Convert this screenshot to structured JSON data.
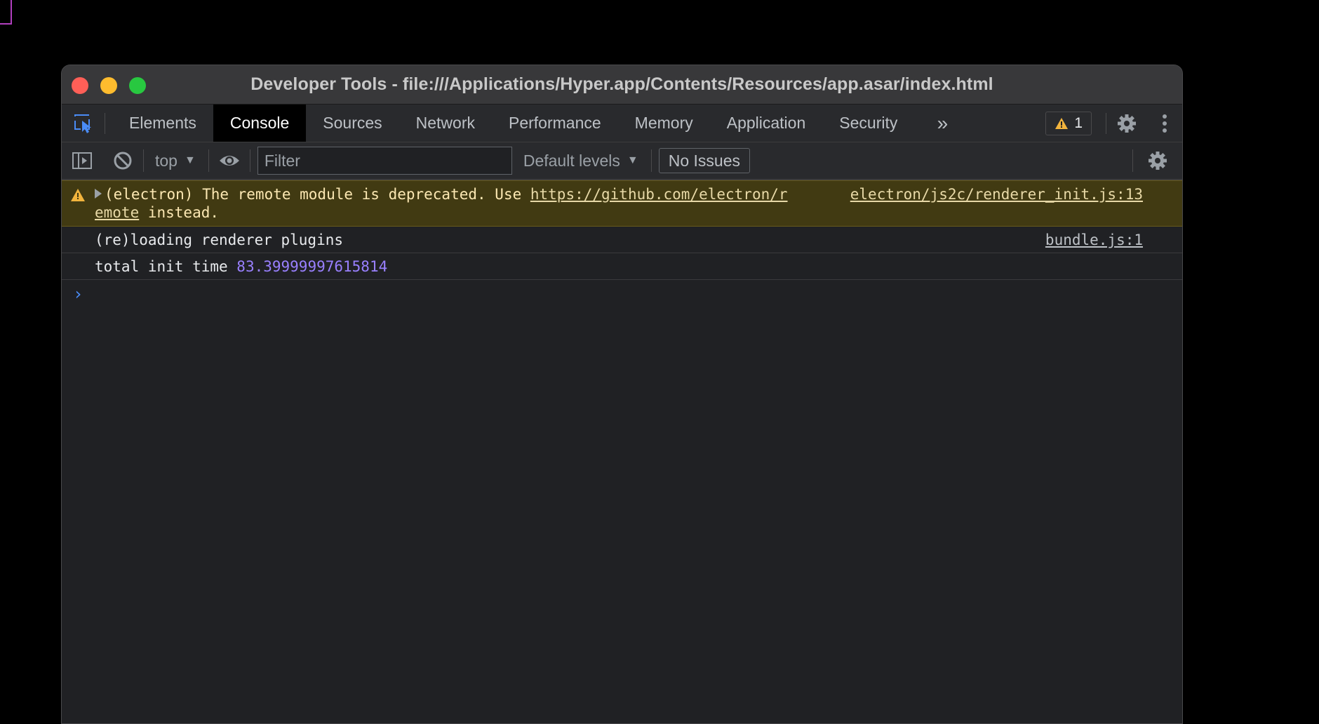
{
  "window": {
    "title": "Developer Tools - file:///Applications/Hyper.app/Contents/Resources/app.asar/index.html"
  },
  "tabs": [
    {
      "label": "Elements",
      "active": false
    },
    {
      "label": "Console",
      "active": true
    },
    {
      "label": "Sources",
      "active": false
    },
    {
      "label": "Network",
      "active": false
    },
    {
      "label": "Performance",
      "active": false
    },
    {
      "label": "Memory",
      "active": false
    },
    {
      "label": "Application",
      "active": false
    },
    {
      "label": "Security",
      "active": false
    }
  ],
  "tabbar": {
    "more_label": "»",
    "warning_count": "1"
  },
  "toolbar": {
    "context": "top",
    "filter_placeholder": "Filter",
    "levels": "Default levels",
    "issues": "No Issues"
  },
  "console": {
    "warning": {
      "text_prefix": "(electron) The remote module is deprecated. Use ",
      "link": "https://github.com/electron/r",
      "link_cont": "emote",
      "text_suffix": " instead.",
      "source": "electron/js2c/renderer_init.js:13"
    },
    "log1": {
      "text": "(re)loading renderer plugins",
      "source": "bundle.js:1"
    },
    "log2": {
      "label": "total init time ",
      "value": "83.39999997615814"
    },
    "prompt": "›"
  },
  "colors": {
    "accent": "#4a8cf7",
    "warning_bg": "#413a12",
    "number": "#9980ff"
  }
}
